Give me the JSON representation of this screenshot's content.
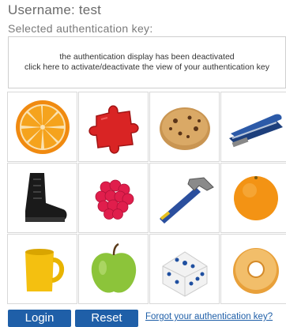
{
  "header": {
    "username_label": "Username: test",
    "selected_key_label": "Selected authentication key:"
  },
  "auth_display": {
    "line1": "the authentication display has been deactivated",
    "line2": "click here to activate/deactivate the view of your authentication key"
  },
  "image_grid": {
    "cells": [
      {
        "icon": "orange-slice-icon"
      },
      {
        "icon": "puzzle-piece-icon"
      },
      {
        "icon": "cookie-icon"
      },
      {
        "icon": "stapler-icon"
      },
      {
        "icon": "boot-icon"
      },
      {
        "icon": "raspberry-icon"
      },
      {
        "icon": "hammer-icon"
      },
      {
        "icon": "orange-icon"
      },
      {
        "icon": "mug-icon"
      },
      {
        "icon": "apple-icon"
      },
      {
        "icon": "dice-icon"
      },
      {
        "icon": "donut-icon"
      }
    ]
  },
  "actions": {
    "login_label": "Login",
    "reset_label": "Reset",
    "forgot_label": "Forgot your authentication key?"
  },
  "colors": {
    "button_blue": "#1f5fa8",
    "link_blue": "#1f5fa8"
  }
}
